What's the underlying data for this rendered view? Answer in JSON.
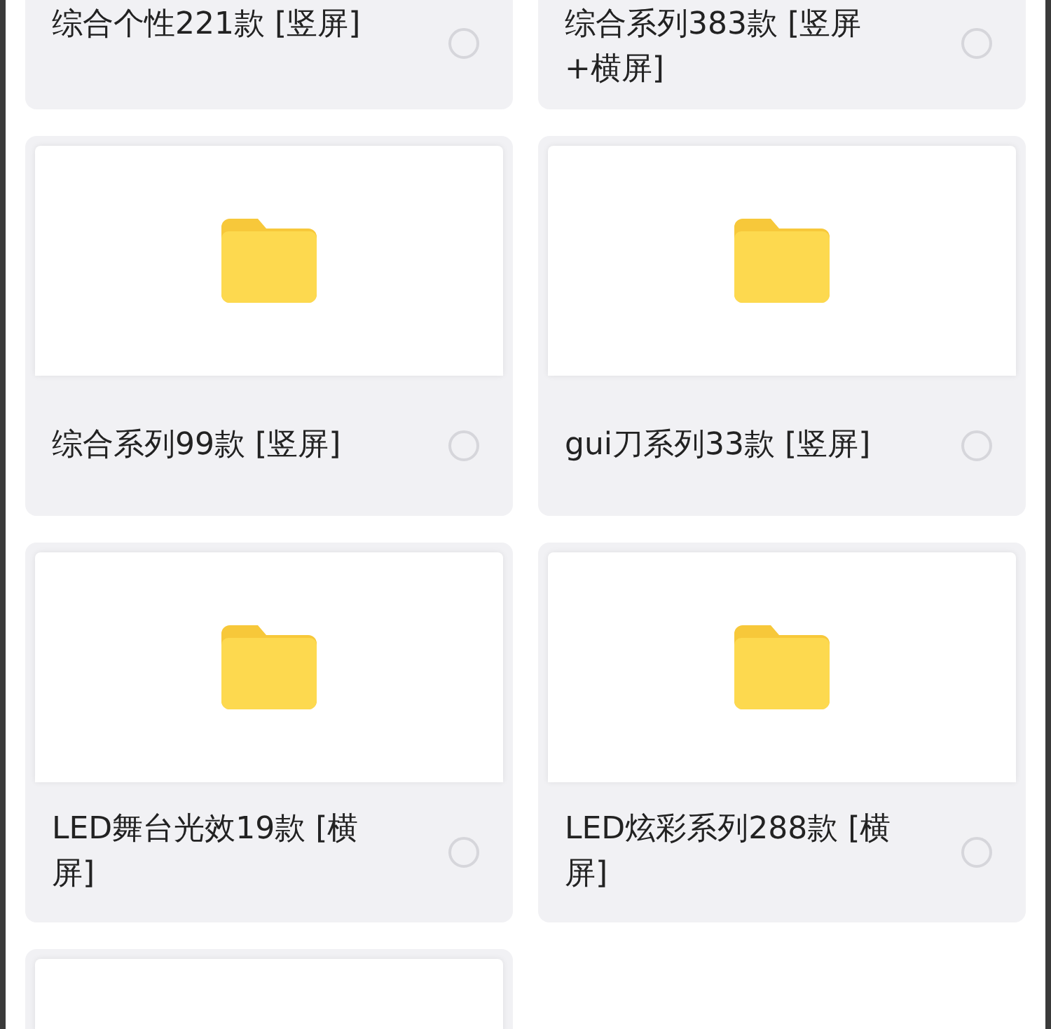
{
  "folders": [
    {
      "kind": "label_only",
      "label": "综合个性221款 [竖屏]",
      "selected": false
    },
    {
      "kind": "label_only",
      "label": "综合系列383款 [竖屏 +横屏]",
      "selected": false
    },
    {
      "kind": "full",
      "label": "综合系列99款 [竖屏]",
      "selected": false
    },
    {
      "kind": "full",
      "label": "gui刀系列33款 [竖屏]",
      "selected": false
    },
    {
      "kind": "full",
      "label": "LED舞台光效19款 [横屏]",
      "selected": false
    },
    {
      "kind": "full",
      "label": "LED炫彩系列288款 [横屏]",
      "selected": false
    },
    {
      "kind": "thumb_top"
    }
  ]
}
